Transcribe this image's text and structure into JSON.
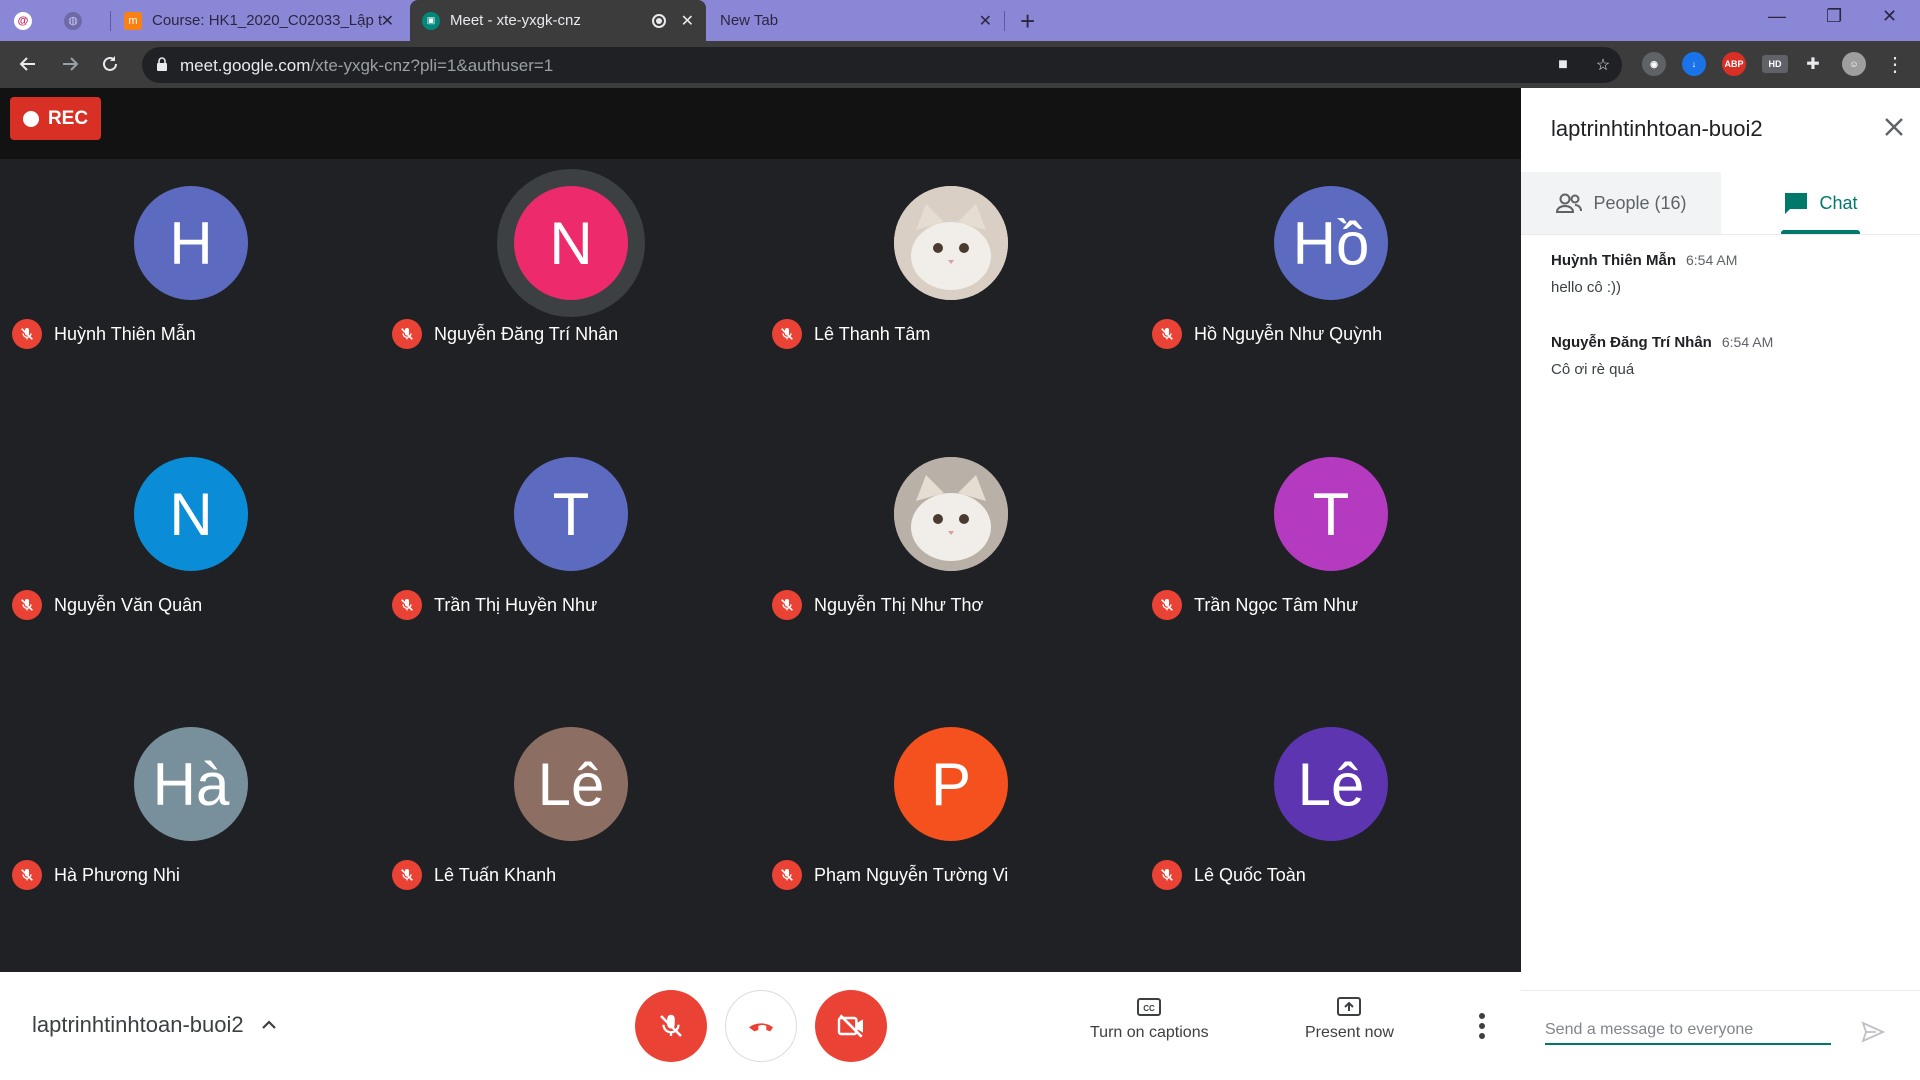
{
  "browser": {
    "tabs": [
      {
        "title": "Course: HK1_2020_C02033_Lập t",
        "favicon": "moodle-icon",
        "active": false
      },
      {
        "title": "Meet - xte-yxgk-cnz",
        "favicon": "meet-icon",
        "active": true
      },
      {
        "title": "New Tab",
        "favicon": "",
        "active": false
      }
    ],
    "url_host": "meet.google.com",
    "url_path": "/xte-yxgk-cnz?pli=1&authuser=1",
    "extensions": [
      "screen-record-icon",
      "download-icon",
      "ABP",
      "HD",
      "puzzle-icon"
    ]
  },
  "meet": {
    "rec_label": "REC",
    "participants": [
      {
        "name": "Huỳnh Thiên Mẫn",
        "initial": "H",
        "color": "#5c6bc0",
        "photo": false
      },
      {
        "name": "Nguyễn Đăng Trí Nhân",
        "initial": "N",
        "color": "#ec2a6c",
        "photo": false,
        "speaking": true
      },
      {
        "name": "Lê Thanh Tâm",
        "initial": "",
        "color": "#d9cfc4",
        "photo": true
      },
      {
        "name": "Hồ Nguyễn Như Quỳnh",
        "initial": "Hồ",
        "color": "#5c6bc0",
        "photo": false
      },
      {
        "name": "Nguyễn Văn Quân",
        "initial": "N",
        "color": "#0a8cd6",
        "photo": false
      },
      {
        "name": "Trần Thị Huyền Như",
        "initial": "T",
        "color": "#5c6bc0",
        "photo": false
      },
      {
        "name": "Nguyễn Thị Như Thơ",
        "initial": "",
        "color": "#b9b0a8",
        "photo": true
      },
      {
        "name": "Trần Ngọc Tâm Như",
        "initial": "T",
        "color": "#b43ac0",
        "photo": false
      },
      {
        "name": "Hà Phương Nhi",
        "initial": "Hà",
        "color": "#78909c",
        "photo": false
      },
      {
        "name": "Lê Tuấn Khanh",
        "initial": "Lê",
        "color": "#8d6e63",
        "photo": false
      },
      {
        "name": "Phạm Nguyễn Tường Vi",
        "initial": "P",
        "color": "#f4511e",
        "photo": false
      },
      {
        "name": "Lê Quốc Toàn",
        "initial": "Lê",
        "color": "#5e35b1",
        "photo": false
      }
    ],
    "bottom": {
      "meeting_name": "laptrinhtinhtoan-buoi2",
      "captions_label": "Turn on captions",
      "present_label": "Present now"
    }
  },
  "panel": {
    "title": "laptrinhtinhtoan-buoi2",
    "people_tab": "People (16)",
    "chat_tab": "Chat",
    "messages": [
      {
        "sender": "Huỳnh Thiên Mẫn",
        "time": "6:54 AM",
        "text": "hello cô :))"
      },
      {
        "sender": "Nguyễn Đăng Trí Nhân",
        "time": "6:54 AM",
        "text": "Cô ơi rè quá"
      }
    ],
    "input_placeholder": "Send a message to everyone"
  }
}
